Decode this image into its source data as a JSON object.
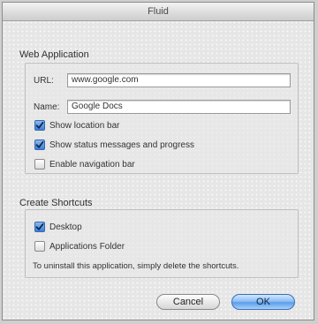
{
  "window": {
    "title": "Fluid"
  },
  "web_application": {
    "title": "Web Application",
    "url_label": "URL:",
    "url_value": "www.google.com",
    "name_label": "Name:",
    "name_value": "Google Docs",
    "options": [
      {
        "label": "Show location bar",
        "checked": true
      },
      {
        "label": "Show status messages and progress",
        "checked": true
      },
      {
        "label": "Enable navigation bar",
        "checked": false
      }
    ]
  },
  "create_shortcuts": {
    "title": "Create Shortcuts",
    "options": [
      {
        "label": "Desktop",
        "checked": true
      },
      {
        "label": "Applications Folder",
        "checked": false
      }
    ],
    "hint": "To uninstall this application, simply delete the shortcuts."
  },
  "buttons": {
    "cancel": "Cancel",
    "ok": "OK"
  },
  "colors": {
    "accent": "#5c9ee8",
    "window_bg": "#e6e6e6"
  }
}
